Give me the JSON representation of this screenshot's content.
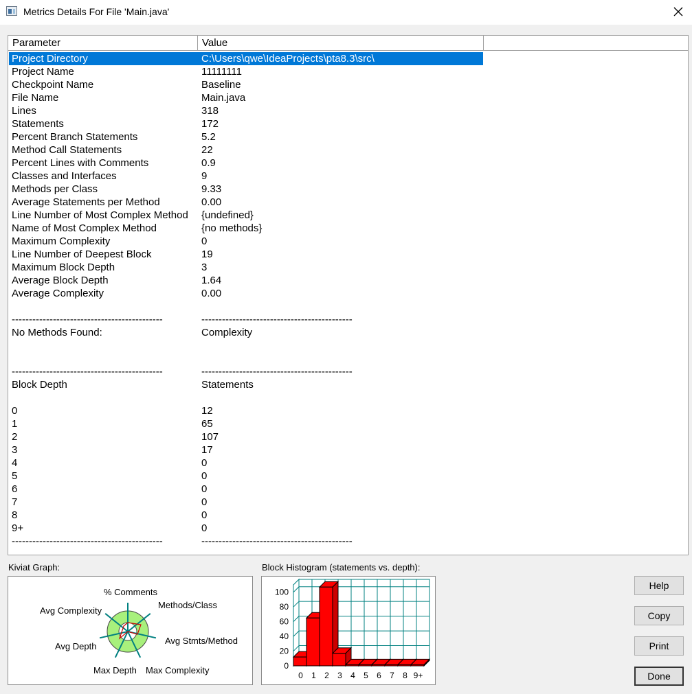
{
  "window": {
    "title": "Metrics Details For File 'Main.java'"
  },
  "table": {
    "columns": [
      "Parameter",
      "Value"
    ],
    "rows": [
      [
        "Project Directory",
        "C:\\Users\\qwe\\IdeaProjects\\pta8.3\\src\\"
      ],
      [
        "Project Name",
        "11111111"
      ],
      [
        "Checkpoint Name",
        "Baseline"
      ],
      [
        "File Name",
        "Main.java"
      ],
      [
        "Lines",
        "318"
      ],
      [
        "Statements",
        "172"
      ],
      [
        "Percent Branch Statements",
        "5.2"
      ],
      [
        "Method Call Statements",
        "22"
      ],
      [
        "Percent Lines with Comments",
        "0.9"
      ],
      [
        "Classes and Interfaces",
        "9"
      ],
      [
        "Methods per Class",
        "9.33"
      ],
      [
        "Average Statements per Method",
        "0.00"
      ],
      [
        "Line Number of Most Complex Method",
        "{undefined}"
      ],
      [
        "Name of Most Complex Method",
        "{no methods}"
      ],
      [
        "Maximum Complexity",
        "0"
      ],
      [
        "Line Number of Deepest Block",
        "19"
      ],
      [
        "Maximum Block Depth",
        "3"
      ],
      [
        "Average Block Depth",
        "1.64"
      ],
      [
        "Average Complexity",
        "0.00"
      ],
      [
        "",
        ""
      ],
      [
        "--------------------------------------------",
        "--------------------------------------------"
      ],
      [
        "No Methods Found:",
        "Complexity"
      ],
      [
        "",
        ""
      ],
      [
        "",
        ""
      ],
      [
        "--------------------------------------------",
        "--------------------------------------------"
      ],
      [
        "Block Depth",
        "Statements"
      ],
      [
        "",
        ""
      ],
      [
        "0",
        "12"
      ],
      [
        "1",
        "65"
      ],
      [
        "2",
        "107"
      ],
      [
        "3",
        "17"
      ],
      [
        "4",
        "0"
      ],
      [
        "5",
        "0"
      ],
      [
        "6",
        "0"
      ],
      [
        "7",
        "0"
      ],
      [
        "8",
        "0"
      ],
      [
        "9+",
        "0"
      ],
      [
        "--------------------------------------------",
        "--------------------------------------------"
      ]
    ]
  },
  "kiviat": {
    "label": "Kiviat Graph:",
    "axes": [
      "% Comments",
      "Methods/Class",
      "Avg Stmts/Method",
      "Max Complexity",
      "Max Depth",
      "Avg Depth",
      "Avg Complexity"
    ],
    "colors": {
      "ring": "#a8f07c",
      "spokes": "#008080",
      "plot": "#cc0000"
    }
  },
  "histogram": {
    "label": "Block Histogram (statements vs. depth):",
    "chart_data": {
      "type": "bar",
      "categories": [
        "0",
        "1",
        "2",
        "3",
        "4",
        "5",
        "6",
        "7",
        "8",
        "9+"
      ],
      "values": [
        12,
        65,
        107,
        17,
        0,
        0,
        0,
        0,
        0,
        0
      ],
      "yticks": [
        "100",
        "80",
        "60",
        "40",
        "20",
        "0"
      ],
      "ylim": [
        0,
        110
      ],
      "bar_color": "#ff0000",
      "grid_color": "#008080",
      "grid": true
    }
  },
  "buttons": {
    "help": "Help",
    "copy": "Copy",
    "print": "Print",
    "done": "Done"
  }
}
